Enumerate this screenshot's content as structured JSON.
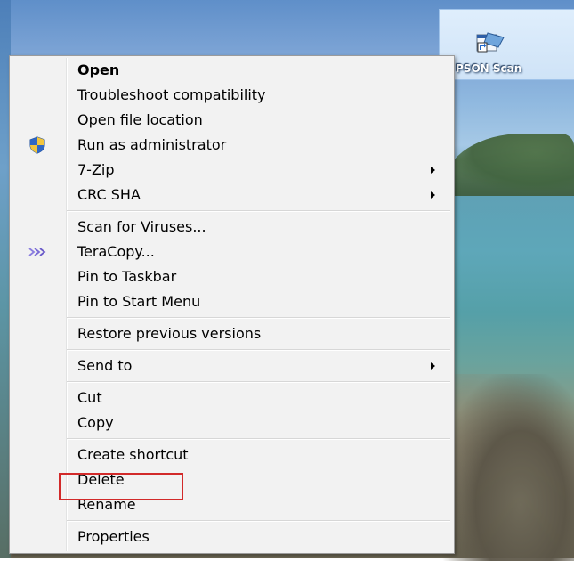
{
  "desktop_icon": {
    "label": "PSON Scan",
    "icon": "shortcut-app-icon"
  },
  "context_menu": {
    "groups": [
      {
        "items": [
          {
            "label": "Open",
            "bold": true,
            "submenu": false,
            "icon": ""
          },
          {
            "label": "Troubleshoot compatibility",
            "bold": false,
            "submenu": false,
            "icon": ""
          },
          {
            "label": "Open file location",
            "bold": false,
            "submenu": false,
            "icon": ""
          },
          {
            "label": "Run as administrator",
            "bold": false,
            "submenu": false,
            "icon": "uac-shield-icon"
          },
          {
            "label": "7-Zip",
            "bold": false,
            "submenu": true,
            "icon": ""
          },
          {
            "label": "CRC SHA",
            "bold": false,
            "submenu": true,
            "icon": ""
          }
        ]
      },
      {
        "items": [
          {
            "label": "Scan for Viruses...",
            "bold": false,
            "submenu": false,
            "icon": ""
          },
          {
            "label": "TeraCopy...",
            "bold": false,
            "submenu": false,
            "icon": "teracopy-icon"
          },
          {
            "label": "Pin to Taskbar",
            "bold": false,
            "submenu": false,
            "icon": ""
          },
          {
            "label": "Pin to Start Menu",
            "bold": false,
            "submenu": false,
            "icon": ""
          }
        ]
      },
      {
        "items": [
          {
            "label": "Restore previous versions",
            "bold": false,
            "submenu": false,
            "icon": ""
          }
        ]
      },
      {
        "items": [
          {
            "label": "Send to",
            "bold": false,
            "submenu": true,
            "icon": ""
          }
        ]
      },
      {
        "items": [
          {
            "label": "Cut",
            "bold": false,
            "submenu": false,
            "icon": ""
          },
          {
            "label": "Copy",
            "bold": false,
            "submenu": false,
            "icon": ""
          }
        ]
      },
      {
        "items": [
          {
            "label": "Create shortcut",
            "bold": false,
            "submenu": false,
            "icon": ""
          },
          {
            "label": "Delete",
            "bold": false,
            "submenu": false,
            "icon": ""
          },
          {
            "label": "Rename",
            "bold": false,
            "submenu": false,
            "icon": ""
          }
        ]
      },
      {
        "items": [
          {
            "label": "Properties",
            "bold": false,
            "submenu": false,
            "icon": "",
            "highlighted": true
          }
        ]
      }
    ],
    "highlight_color": "#d22a2a"
  }
}
